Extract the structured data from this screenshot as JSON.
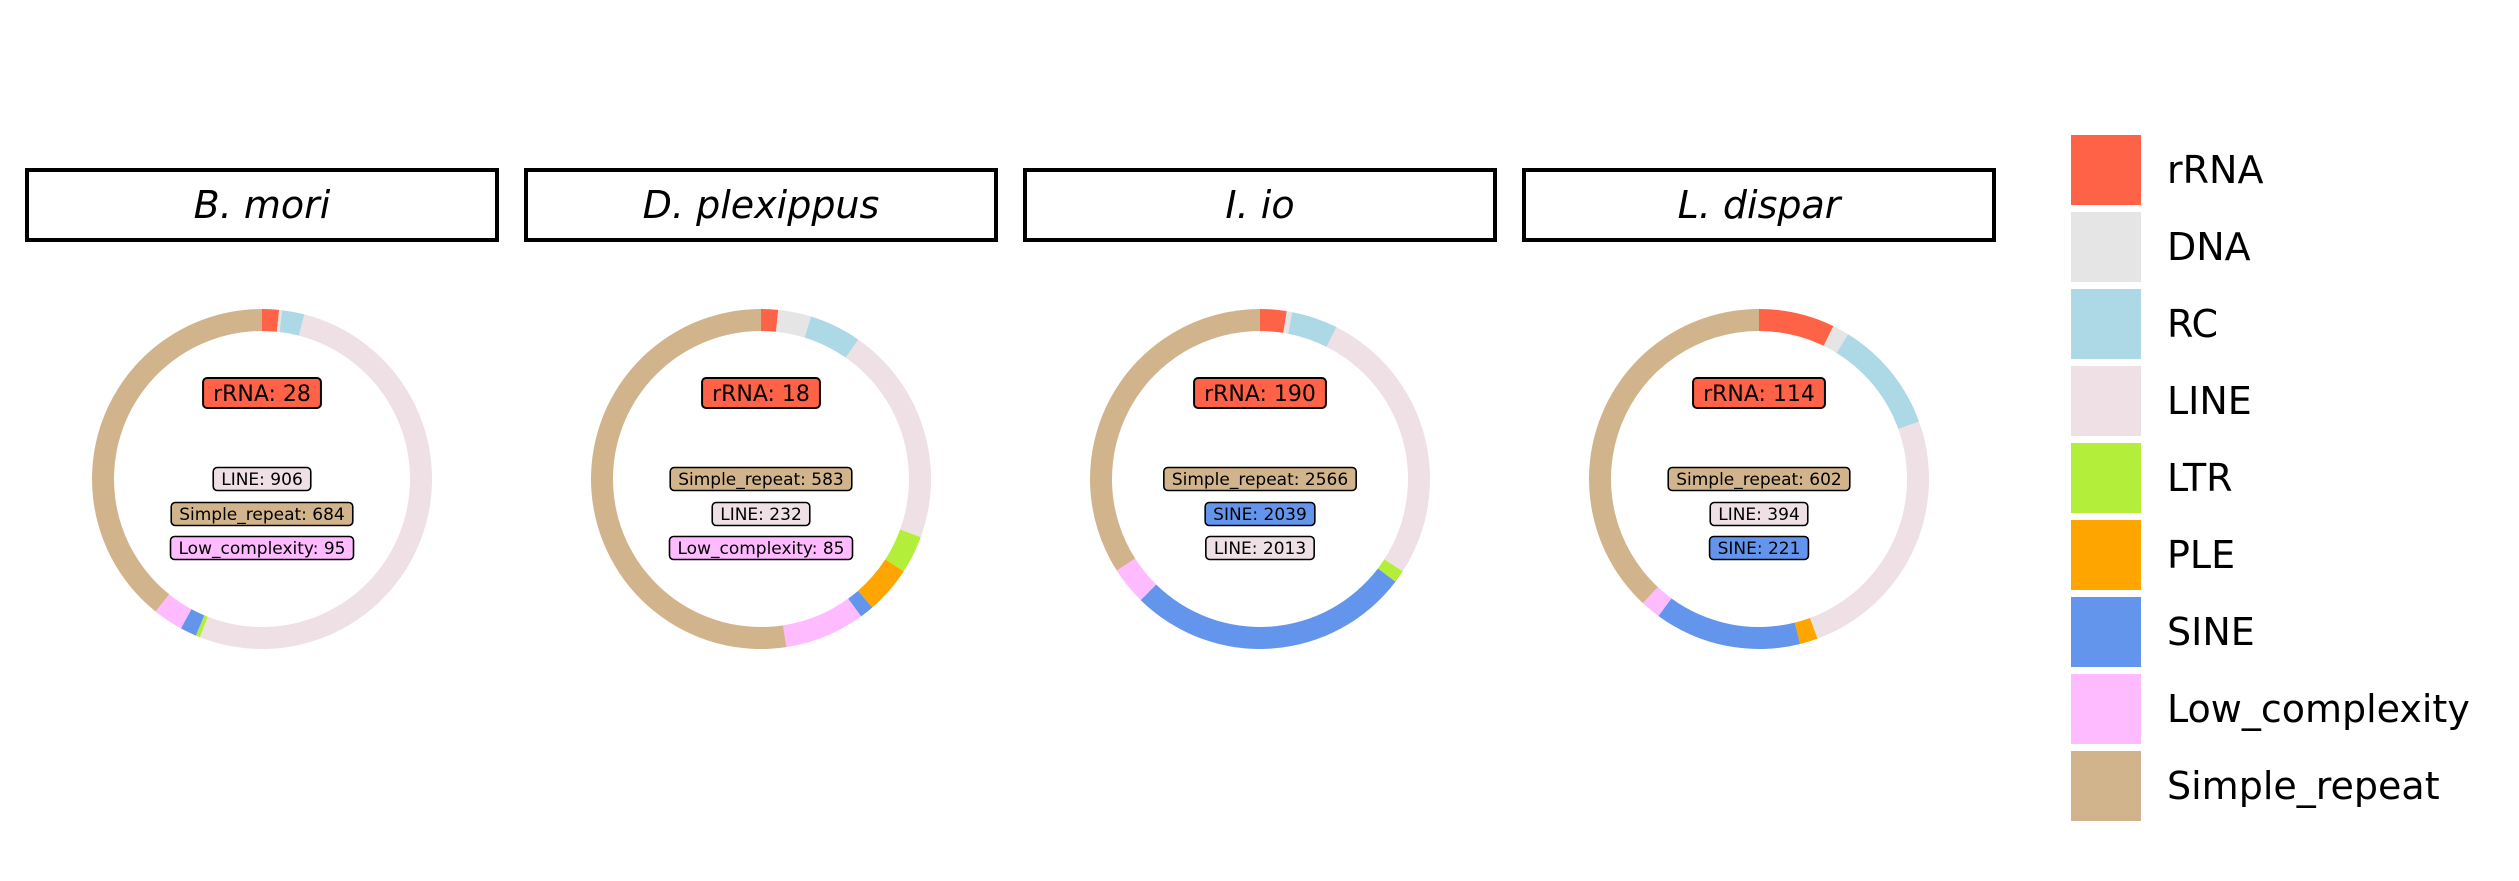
{
  "colors": {
    "rRNA": "#ff6347",
    "DNA": "#e5e5e5",
    "RC": "#add8e6",
    "LINE": "#eee0e5",
    "LTR": "#b3ee3a",
    "PLE": "#ffa500",
    "SINE": "#6495ed",
    "Low_complexity": "#ffbbff",
    "Simple_repeat": "#d2b48c"
  },
  "legend": {
    "items": [
      {
        "key": "rRNA",
        "label": "rRNA"
      },
      {
        "key": "DNA",
        "label": "DNA"
      },
      {
        "key": "RC",
        "label": "RC"
      },
      {
        "key": "LINE",
        "label": "LINE"
      },
      {
        "key": "LTR",
        "label": "LTR"
      },
      {
        "key": "PLE",
        "label": "PLE"
      },
      {
        "key": "SINE",
        "label": "SINE"
      },
      {
        "key": "Low_complexity",
        "label": "Low_complexity"
      },
      {
        "key": "Simple_repeat",
        "label": "Simple_repeat"
      }
    ]
  },
  "chart_data": [
    {
      "type": "pie",
      "style": "donut",
      "title": "B. mori",
      "categories": [
        "rRNA",
        "DNA",
        "RC",
        "LINE",
        "LTR",
        "PLE",
        "SINE",
        "Low_complexity",
        "Simple_repeat"
      ],
      "values": [
        28,
        5,
        37,
        906,
        7,
        0,
        27,
        50,
        684
      ],
      "labels": [
        {
          "text": "rRNA: 28",
          "category": "rRNA",
          "size": "large"
        },
        {
          "text": "LINE: 906",
          "category": "LINE",
          "size": "small"
        },
        {
          "text": "Simple_repeat: 684",
          "category": "Simple_repeat",
          "size": "small"
        },
        {
          "text": "Low_complexity: 95",
          "category": "Low_complexity",
          "size": "small"
        }
      ]
    },
    {
      "type": "pie",
      "style": "donut",
      "title": "D. plexippus",
      "categories": [
        "rRNA",
        "DNA",
        "RC",
        "LINE",
        "LTR",
        "PLE",
        "SINE",
        "Low_complexity",
        "Simple_repeat"
      ],
      "values": [
        18,
        35,
        55,
        232,
        40,
        50,
        15,
        85,
        583
      ],
      "labels": [
        {
          "text": "rRNA: 18",
          "category": "rRNA",
          "size": "large"
        },
        {
          "text": "Simple_repeat: 583",
          "category": "Simple_repeat",
          "size": "small"
        },
        {
          "text": "LINE: 232",
          "category": "LINE",
          "size": "small"
        },
        {
          "text": "Low_complexity: 85",
          "category": "Low_complexity",
          "size": "small"
        }
      ]
    },
    {
      "type": "pie",
      "style": "donut",
      "title": "I. io",
      "categories": [
        "rRNA",
        "DNA",
        "RC",
        "LINE",
        "LTR",
        "PLE",
        "SINE",
        "Low_complexity",
        "Simple_repeat"
      ],
      "values": [
        190,
        40,
        330,
        2013,
        90,
        0,
        2039,
        270,
        2566
      ],
      "labels": [
        {
          "text": "rRNA: 190",
          "category": "rRNA",
          "size": "large"
        },
        {
          "text": "Simple_repeat: 2566",
          "category": "Simple_repeat",
          "size": "small"
        },
        {
          "text": "SINE: 2039",
          "category": "SINE",
          "size": "small"
        },
        {
          "text": "LINE: 2013",
          "category": "LINE",
          "size": "small"
        }
      ]
    },
    {
      "type": "pie",
      "style": "donut",
      "title": "L. dispar",
      "categories": [
        "rRNA",
        "DNA",
        "RC",
        "LINE",
        "LTR",
        "PLE",
        "SINE",
        "Low_complexity",
        "Simple_repeat"
      ],
      "values": [
        114,
        25,
        170,
        394,
        0,
        27,
        221,
        30,
        602
      ],
      "labels": [
        {
          "text": "rRNA: 114",
          "category": "rRNA",
          "size": "large"
        },
        {
          "text": "Simple_repeat: 602",
          "category": "Simple_repeat",
          "size": "small"
        },
        {
          "text": "LINE: 394",
          "category": "LINE",
          "size": "small"
        },
        {
          "text": "SINE: 221",
          "category": "SINE",
          "size": "small"
        }
      ]
    }
  ]
}
